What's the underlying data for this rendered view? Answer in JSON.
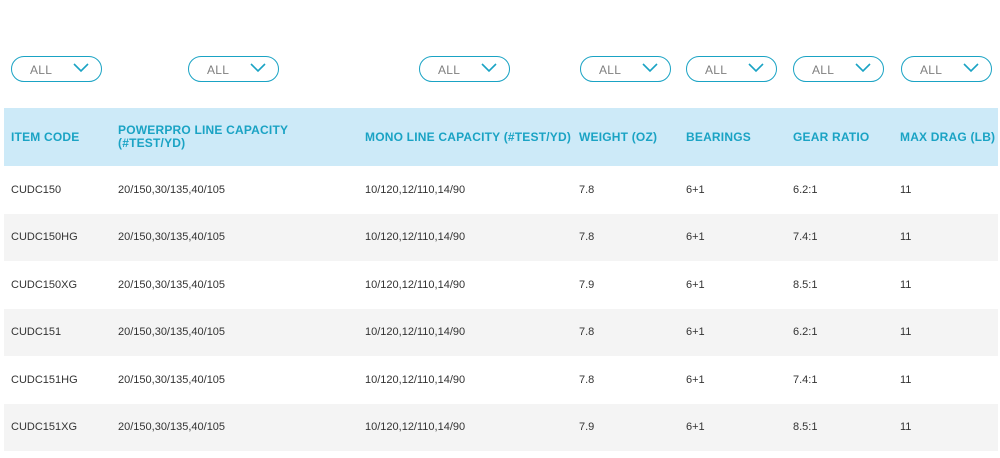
{
  "filters": [
    {
      "label": "ALL"
    },
    {
      "label": "ALL"
    },
    {
      "label": "ALL"
    },
    {
      "label": "ALL"
    },
    {
      "label": "ALL"
    },
    {
      "label": "ALL"
    },
    {
      "label": "ALL"
    }
  ],
  "table": {
    "headers": [
      "ITEM CODE",
      "POWERPRO LINE CAPACITY (#TEST/YD)",
      "MONO LINE CAPACITY (#TEST/YD)",
      "WEIGHT (OZ)",
      "BEARINGS",
      "GEAR RATIO",
      "MAX DRAG (LB)"
    ],
    "rows": [
      [
        "CUDC150",
        "20/150,30/135,40/105",
        "10/120,12/110,14/90",
        "7.8",
        "6+1",
        "6.2:1",
        "11"
      ],
      [
        "CUDC150HG",
        "20/150,30/135,40/105",
        "10/120,12/110,14/90",
        "7.8",
        "6+1",
        "7.4:1",
        "11"
      ],
      [
        "CUDC150XG",
        "20/150,30/135,40/105",
        "10/120,12/110,14/90",
        "7.9",
        "6+1",
        "8.5:1",
        "11"
      ],
      [
        "CUDC151",
        "20/150,30/135,40/105",
        "10/120,12/110,14/90",
        "7.8",
        "6+1",
        "6.2:1",
        "11"
      ],
      [
        "CUDC151HG",
        "20/150,30/135,40/105",
        "10/120,12/110,14/90",
        "7.8",
        "6+1",
        "7.4:1",
        "11"
      ],
      [
        "CUDC151XG",
        "20/150,30/135,40/105",
        "10/120,12/110,14/90",
        "7.9",
        "6+1",
        "8.5:1",
        "11"
      ]
    ]
  },
  "colors": {
    "accent": "#1aa3c4",
    "header_bg": "#cdeaf8",
    "row_alt_bg": "#f4f4f4"
  }
}
